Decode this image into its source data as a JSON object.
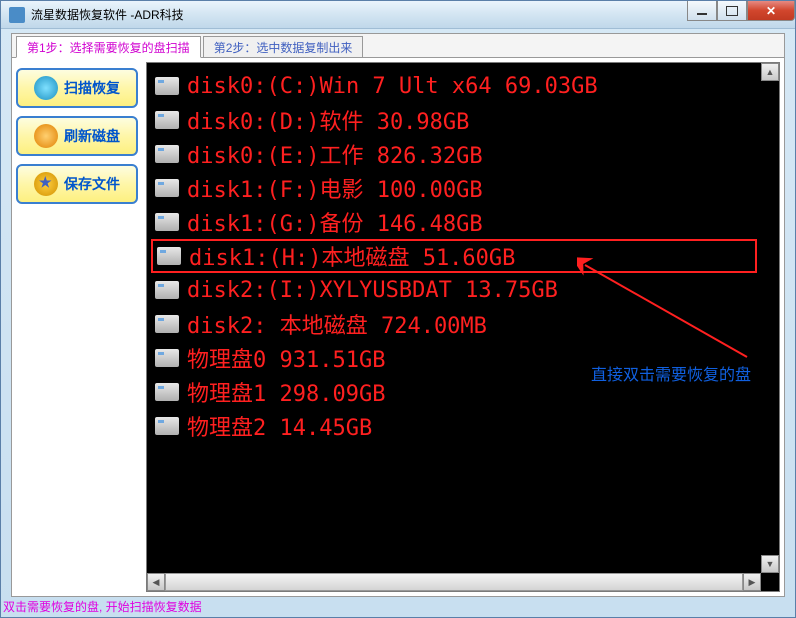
{
  "window": {
    "title": "流星数据恢复软件   -ADR科技"
  },
  "tabs": [
    {
      "label": "第1步：选择需要恢复的盘扫描",
      "active": true
    },
    {
      "label": "第2步：选中数据复制出来",
      "active": false
    }
  ],
  "sidebar": {
    "scan": "扫描恢复",
    "refresh": "刷新磁盘",
    "save": "保存文件"
  },
  "disks": [
    {
      "text": "disk0:(C:)Win 7 Ult x64 69.03GB",
      "selected": false
    },
    {
      "text": "disk0:(D:)软件 30.98GB",
      "selected": false
    },
    {
      "text": "disk0:(E:)工作 826.32GB",
      "selected": false
    },
    {
      "text": "disk1:(F:)电影 100.00GB",
      "selected": false
    },
    {
      "text": "disk1:(G:)备份 146.48GB",
      "selected": false
    },
    {
      "text": "disk1:(H:)本地磁盘 51.60GB",
      "selected": true
    },
    {
      "text": "disk2:(I:)XYLYUSBDAT 13.75GB",
      "selected": false
    },
    {
      "text": "disk2:    本地磁盘 724.00MB",
      "selected": false
    },
    {
      "text": "物理盘0 931.51GB",
      "selected": false
    },
    {
      "text": "物理盘1 298.09GB",
      "selected": false
    },
    {
      "text": "物理盘2 14.45GB",
      "selected": false
    }
  ],
  "annotation": "直接双击需要恢复的盘",
  "statusbar": "双击需要恢复的盘, 开始扫描恢复数据"
}
